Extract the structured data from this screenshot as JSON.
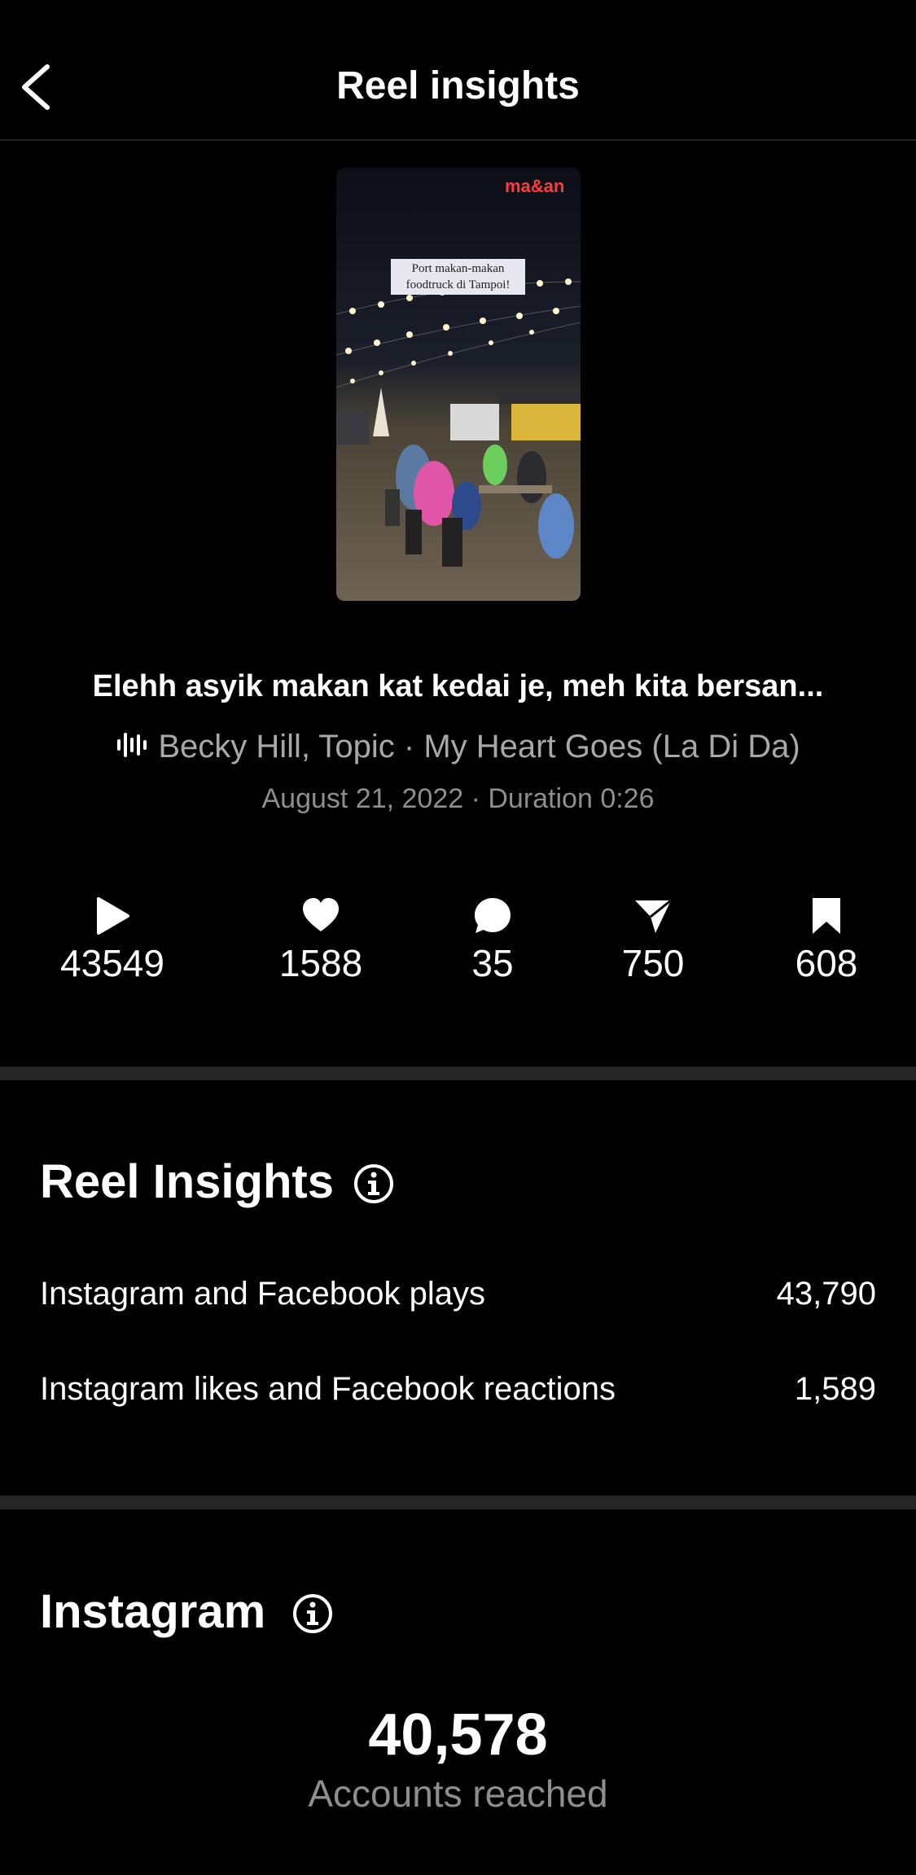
{
  "header": {
    "title": "Reel insights",
    "back_icon": "chevron-left-icon"
  },
  "thumbnail": {
    "brand": "ma&an",
    "overlay_text_line1": "Port makan-makan",
    "overlay_text_line2": "foodtruck di Tampoi!"
  },
  "reel": {
    "caption": "Elehh asyik makan kat kedai je, meh kita bersan...",
    "audio": "Becky Hill, Topic · My Heart Goes (La Di Da)",
    "meta": "August 21, 2022 · Duration 0:26"
  },
  "stats": {
    "plays": "43549",
    "likes": "1588",
    "comments": "35",
    "shares": "750",
    "saves": "608"
  },
  "reel_insights": {
    "title": "Reel Insights",
    "rows": [
      {
        "label": "Instagram and Facebook plays",
        "value": "43,790"
      },
      {
        "label": "Instagram likes and Facebook reactions",
        "value": "1,589"
      }
    ]
  },
  "instagram": {
    "title": "Instagram",
    "accounts_reached": "40,578",
    "accounts_reached_label": "Accounts reached"
  },
  "colors": {
    "background": "#000000",
    "divider": "#262626",
    "secondary_text": "#8e8e8e"
  }
}
